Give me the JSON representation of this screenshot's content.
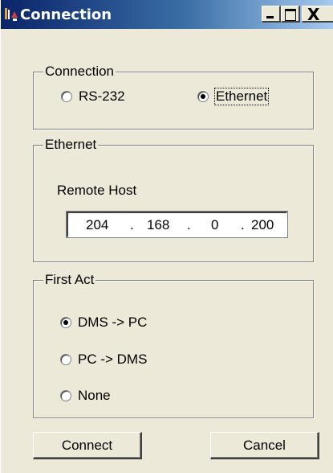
{
  "window": {
    "title": "Connection"
  },
  "titlebar_buttons": {
    "minimize": "_",
    "maximize": "□",
    "close": "X"
  },
  "connection": {
    "legend": "Connection",
    "options": [
      {
        "label": "RS-232",
        "checked": false
      },
      {
        "label": "Ethernet",
        "checked": true
      }
    ]
  },
  "ethernet": {
    "legend": "Ethernet",
    "remote_host_label": "Remote Host",
    "ip": {
      "oct1": "204",
      "oct2": "168",
      "oct3": "0",
      "oct4": "200",
      "dot": "."
    }
  },
  "first_act": {
    "legend": "First Act",
    "options": [
      {
        "label": "DMS -> PC",
        "checked": true
      },
      {
        "label": "PC -> DMS",
        "checked": false
      },
      {
        "label": "None",
        "checked": false
      }
    ]
  },
  "buttons": {
    "connect": "Connect",
    "cancel": "Cancel"
  }
}
